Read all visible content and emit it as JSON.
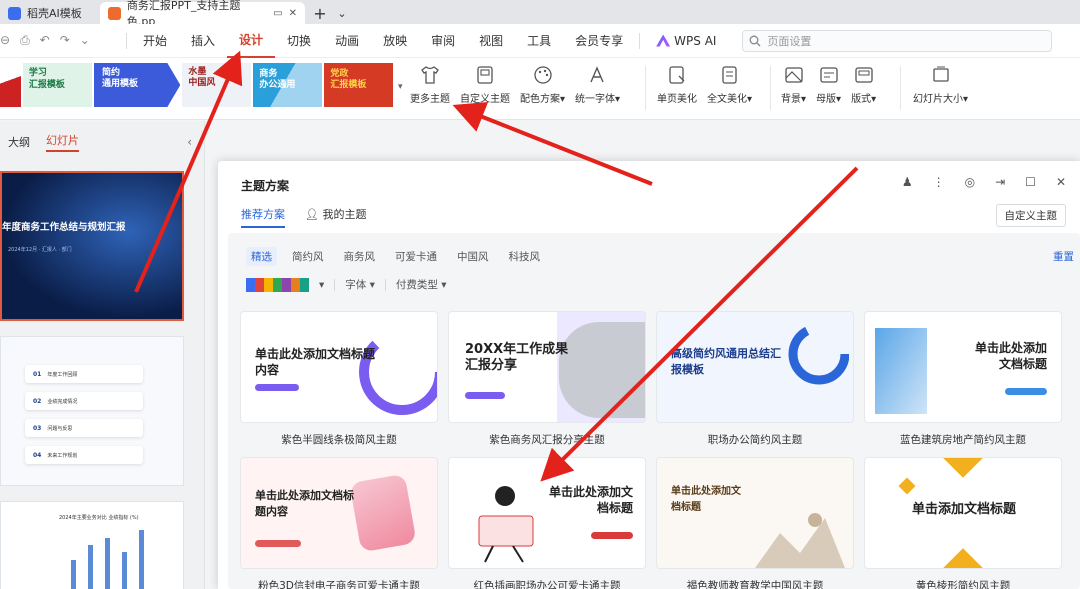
{
  "tabs": {
    "first": "稻壳AI模板",
    "active": "商务汇报PPT_支持主题色.pp",
    "plus": "+",
    "more": "⌄"
  },
  "menu": {
    "items": [
      "开始",
      "插入",
      "设计",
      "切换",
      "动画",
      "放映",
      "审阅",
      "视图",
      "工具",
      "会员专享"
    ],
    "active_index": 2,
    "wps_ai": "WPS AI",
    "search_placeholder": "页面设置"
  },
  "ribbon": {
    "strip_themes": [
      {
        "line1": "学习",
        "line2": "汇报模板"
      },
      {
        "line1": "简约",
        "line2": "通用模板"
      },
      {
        "line1": "水墨",
        "line2": "中国风"
      },
      {
        "line1": "商务",
        "line2": "办公通用"
      },
      {
        "line1": "党政",
        "line2": "汇报模板"
      }
    ],
    "buttons": [
      "更多主题",
      "自定义主题",
      "配色方案",
      "统一字体",
      "单页美化",
      "全文美化",
      "背景",
      "母版",
      "版式",
      "幻灯片大小"
    ],
    "dropdown_mark": "▾"
  },
  "left_panel": {
    "tab_outline": "大纲",
    "tab_slides": "幻灯片",
    "collapse": "‹",
    "slide1_title": "年度商务工作总结与规划汇报",
    "slide1_sub": "2024年12月 · 汇报人 · 部门",
    "agenda": [
      {
        "no": "01",
        "text": "年度工作回顾"
      },
      {
        "no": "02",
        "text": "业绩完成情况"
      },
      {
        "no": "03",
        "text": "问题与反思"
      },
      {
        "no": "04",
        "text": "未来工作规划"
      }
    ],
    "slide3_title": "2024年主要业务对比 业绩指标 (%)",
    "slide3_bars": [
      40,
      55,
      62,
      48,
      70
    ]
  },
  "dialog": {
    "title": "主题方案",
    "tab_recommended": "推荐方案",
    "tab_mine": "我的主题",
    "custom_button": "自定义主题",
    "categories": [
      "精选",
      "简约风",
      "商务风",
      "可爱卡通",
      "中国风",
      "科技风"
    ],
    "active_category": 0,
    "reset": "重置",
    "filter_font": "字体",
    "filter_pay": "付费类型",
    "swatch_colors": [
      "#3a6df0",
      "#e0443a",
      "#f4b400",
      "#2fa84f",
      "#8e44ad",
      "#e67e22",
      "#16a085"
    ],
    "cards": [
      {
        "caption": "紫色半圆线条极简风主题",
        "title": "单击此处添加文档标题内容",
        "year": "",
        "accent": "#7b5cf0"
      },
      {
        "caption": "紫色商务风汇报分享主题",
        "title": "20XX年工作成果汇报分享",
        "year": "",
        "accent": "#7b5cf0"
      },
      {
        "caption": "职场办公简约风主题",
        "title": "高级简约风通用总结汇报模板",
        "year": "",
        "accent": "#2b66d9"
      },
      {
        "caption": "蓝色建筑房地产简约风主题",
        "title": "单击此处添加文档标题",
        "year": "",
        "accent": "#3a8ee6"
      },
      {
        "caption": "粉色3D信封电子商务可爱卡通主题",
        "title": "单击此处添加文档标题内容",
        "year": "",
        "accent": "#e05a5a"
      },
      {
        "caption": "红色插画职场办公可爱卡通主题",
        "title": "单击此处添加文档标题",
        "year": "",
        "accent": "#d93b3b"
      },
      {
        "caption": "褐色教师教育教学中国风主题",
        "title": "单击此处添加文档标题",
        "year": "",
        "accent": "#8b5a2b"
      },
      {
        "caption": "黄色棱形简约风主题",
        "title": "单击添加文档标题",
        "year": "",
        "accent": "#f2b01e"
      }
    ]
  },
  "colors": {
    "accent_red": "#d2432c",
    "accent_blue": "#2b66d9",
    "arrow_red": "#e3221c"
  },
  "icons": [
    "undo-icon",
    "redo-icon",
    "search-icon",
    "shirt-icon",
    "palette-icon",
    "font-icon",
    "beautify-icon",
    "background-icon",
    "slide-size-icon",
    "close-icon"
  ]
}
